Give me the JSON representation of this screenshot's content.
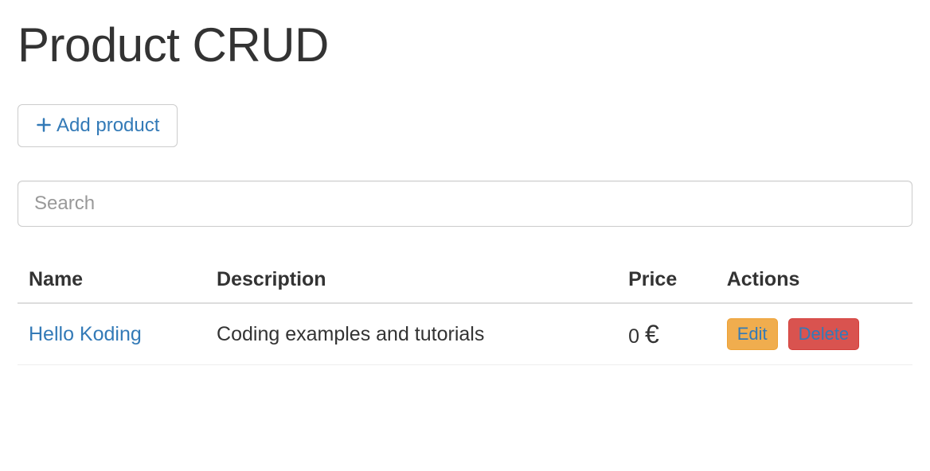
{
  "header": {
    "title": "Product CRUD"
  },
  "toolbar": {
    "add_label": "Add product"
  },
  "search": {
    "placeholder": "Search",
    "value": ""
  },
  "table": {
    "columns": {
      "name": "Name",
      "description": "Description",
      "price": "Price",
      "actions": "Actions"
    },
    "rows": [
      {
        "name": "Hello Koding",
        "description": "Coding examples and tutorials",
        "price": "0",
        "currency": "€",
        "edit_label": "Edit",
        "delete_label": "Delete"
      }
    ]
  }
}
